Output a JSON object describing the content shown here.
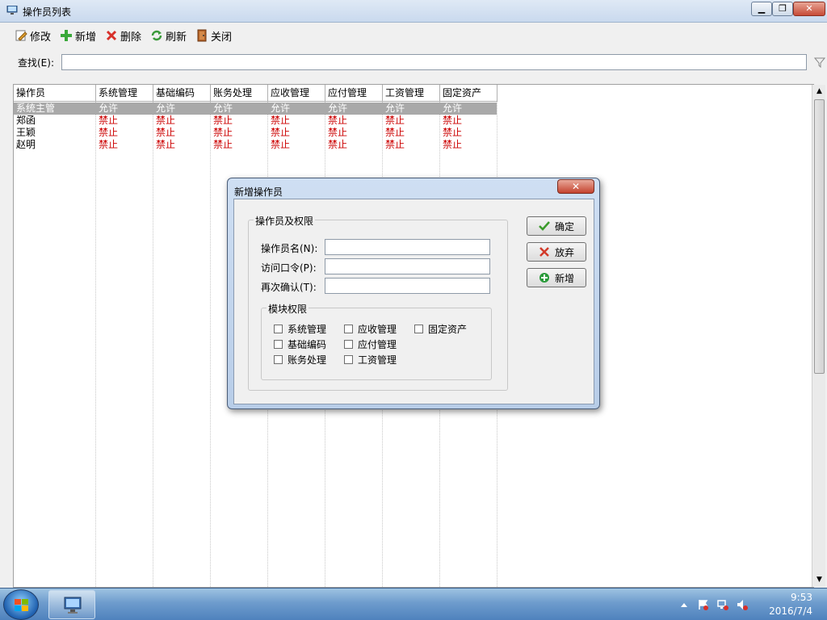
{
  "window": {
    "title": "操作员列表",
    "min_glyph": "▁",
    "max_glyph": "❐",
    "close_glyph": "✕"
  },
  "toolbar": {
    "edit": "修改",
    "add": "新增",
    "delete": "删除",
    "refresh": "刷新",
    "close": "关闭"
  },
  "search": {
    "label": "查找(E):",
    "value": ""
  },
  "grid": {
    "columns": [
      "操作员",
      "系统管理",
      "基础编码",
      "账务处理",
      "应收管理",
      "应付管理",
      "工资管理",
      "固定资产"
    ],
    "rows": [
      {
        "name": "系统主管",
        "perms": [
          "允许",
          "允许",
          "允许",
          "允许",
          "允许",
          "允许",
          "允许"
        ]
      },
      {
        "name": "郑函",
        "perms": [
          "禁止",
          "禁止",
          "禁止",
          "禁止",
          "禁止",
          "禁止",
          "禁止"
        ]
      },
      {
        "name": "王颖",
        "perms": [
          "禁止",
          "禁止",
          "禁止",
          "禁止",
          "禁止",
          "禁止",
          "禁止"
        ]
      },
      {
        "name": "赵明",
        "perms": [
          "禁止",
          "禁止",
          "禁止",
          "禁止",
          "禁止",
          "禁止",
          "禁止"
        ]
      }
    ]
  },
  "dialog": {
    "title": "新增操作员",
    "close_glyph": "✕",
    "group_title": "操作员及权限",
    "fields": [
      {
        "label": "操作员名(N):",
        "value": ""
      },
      {
        "label": "访问口令(P):",
        "value": ""
      },
      {
        "label": "再次确认(T):",
        "value": ""
      }
    ],
    "modules_title": "模块权限",
    "modules": [
      "系统管理",
      "应收管理",
      "固定资产",
      "基础编码",
      "应付管理",
      "账务处理",
      "工资管理"
    ],
    "buttons": {
      "ok": "确定",
      "cancel": "放弃",
      "add": "新增"
    }
  },
  "taskbar": {
    "time": "9:53",
    "date": "2016/7/4"
  },
  "colors": {
    "deny": "#cc0000",
    "selected_row": "#a9a9a9",
    "ok_check": "#3a9a2a",
    "cancel_x": "#d23a2a",
    "add_plus": "#2a9a3a"
  }
}
